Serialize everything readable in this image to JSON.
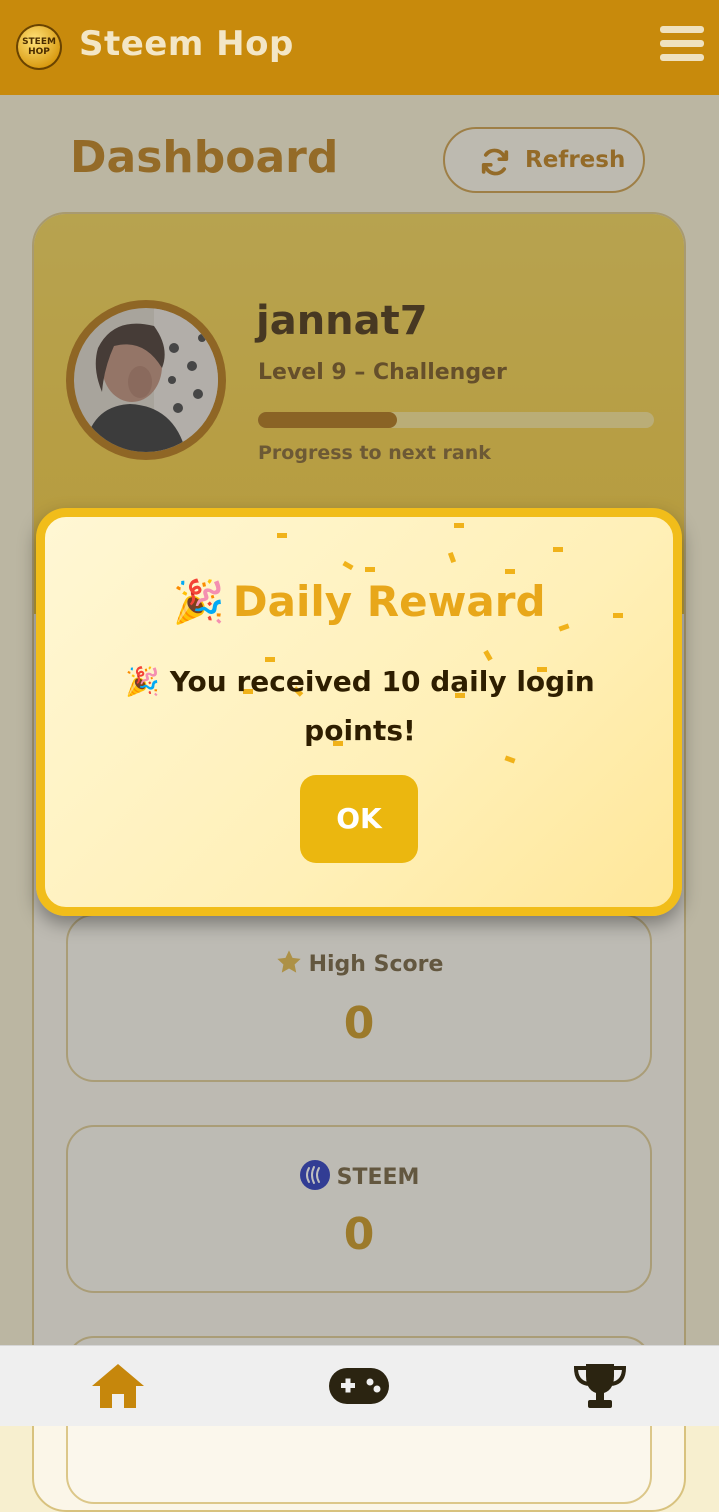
{
  "app": {
    "title": "Steem Hop",
    "logo_text": "STEEM HOP"
  },
  "header": {
    "page_title": "Dashboard",
    "refresh_label": "Refresh"
  },
  "profile": {
    "username": "jannat7",
    "level": "Level 9 – Challenger",
    "progress_fraction": 0.35,
    "progress_caption": "Progress to next rank"
  },
  "stats": {
    "high_score": {
      "label": "High Score",
      "value": "0",
      "icon": "star-icon"
    },
    "steem": {
      "label": "STEEM",
      "value": "0",
      "icon": "steem-logo-icon"
    }
  },
  "modal": {
    "title": "Daily Reward",
    "title_emoji": "🎉",
    "message": "🎉 You received 10 daily login points!",
    "ok_label": "OK"
  },
  "nav": {
    "items": [
      "home-icon",
      "gamepad-icon",
      "trophy-icon"
    ]
  },
  "colors": {
    "topbar": "#c88a0c",
    "accent": "#b8760a",
    "modal_border": "#f1bd1a",
    "ok_button": "#ebb70f"
  }
}
